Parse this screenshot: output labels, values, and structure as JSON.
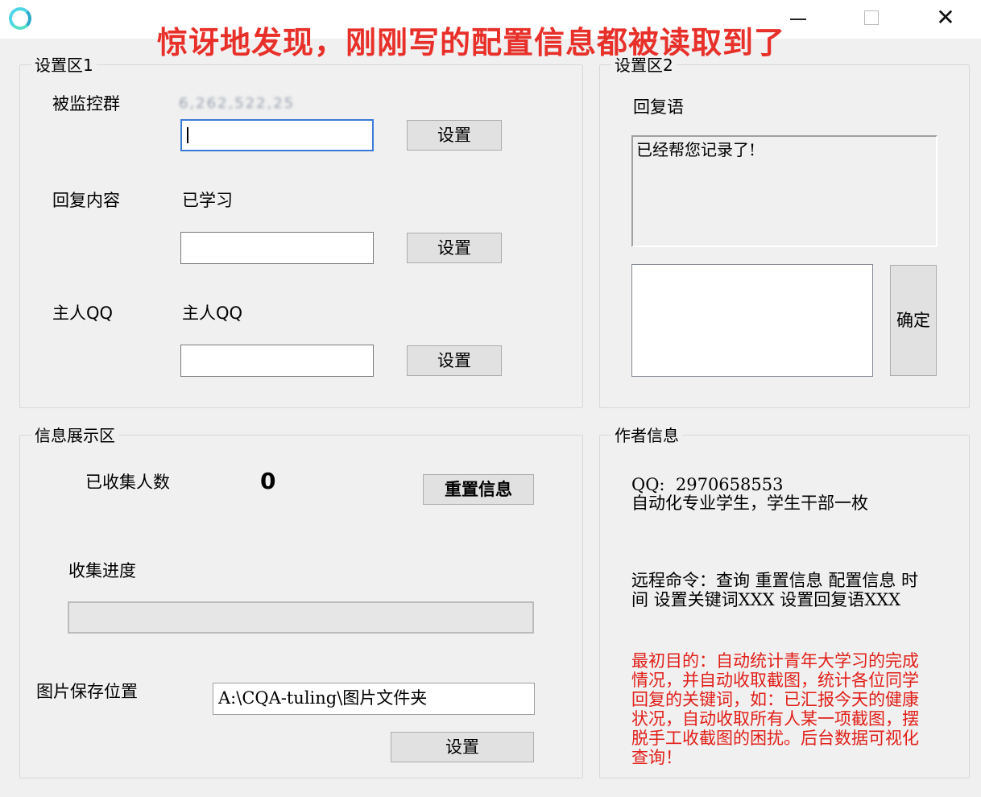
{
  "window": {
    "icon": "app-ring-icon",
    "minimize_glyph": "minimize-icon",
    "maximize_glyph": "maximize-icon",
    "close_glyph": "✕"
  },
  "banner": "惊讶地发现，刚刚写的配置信息都被读取到了",
  "group1": {
    "legend": "设置区1",
    "monitored_group_label": "被监控群",
    "monitored_group_value": "6,262,522,25",
    "monitored_group_input": "",
    "set_label": "设置",
    "reply_content_label": "回复内容",
    "reply_content_value": "已学习",
    "reply_content_input": "",
    "owner_qq_label": "主人QQ",
    "owner_qq_value": "主人QQ",
    "owner_qq_input": ""
  },
  "group2": {
    "legend": "设置区2",
    "reply_label": "回复语",
    "reply_text": "已经帮您记录了!",
    "new_reply_input": "",
    "confirm_label": "确定"
  },
  "info_group": {
    "legend": "信息展示区",
    "collected_label": "已收集人数",
    "collected_count": "0",
    "reset_label": "重置信息",
    "progress_label": "收集进度",
    "progress_value": 0,
    "save_path_label": "图片保存位置",
    "save_path_value": "A:\\CQA-tuling\\图片文件夹",
    "set_label": "设置"
  },
  "author_group": {
    "legend": "作者信息",
    "qq_line": "QQ:  2970658553",
    "bio": "自动化专业学生，学生干部一枚",
    "commands": "远程命令：查询 重置信息 配置信息 时间 设置关键词XXX 设置回复语XXX",
    "purpose": "最初目的：自动统计青年大学习的完成情况，并自动收取截图，统计各位同学回复的关键词，如：已汇报今天的健康状况，自动收取所有人某一项截图，摆脱手工收截图的困扰。后台数据可视化查询！",
    "purpose_color": "#e0201a"
  },
  "colors": {
    "banner": "#e8302a",
    "focus_border": "#3a7ad8",
    "background": "#f0f0f0"
  }
}
